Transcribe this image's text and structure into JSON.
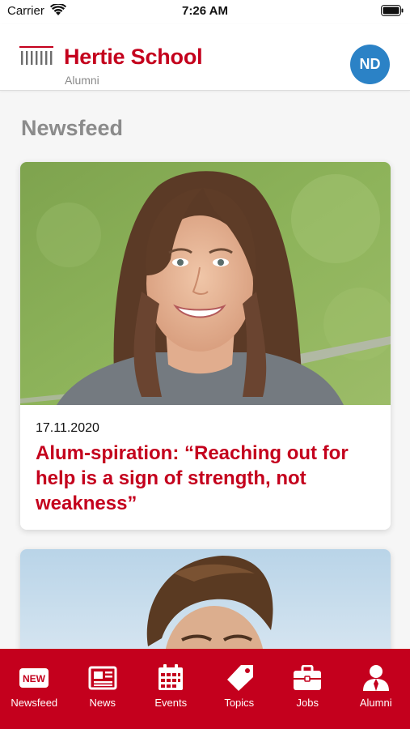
{
  "status_bar": {
    "carrier": "Carrier",
    "time": "7:26 AM"
  },
  "header": {
    "title": "Hertie School",
    "subtitle": "Alumni",
    "avatar_initials": "ND",
    "brand_color": "#c4001d",
    "avatar_color": "#2b82c6"
  },
  "page": {
    "title": "Newsfeed"
  },
  "cards": [
    {
      "date": "17.11.2020",
      "title": "Alum-spiration: “Reaching out for help is a sign of strength, not weakness”",
      "image": "portrait-woman-smiling-grass-background"
    },
    {
      "image": "portrait-man-sky-background"
    }
  ],
  "tab_bar": {
    "items": [
      {
        "label": "Newsfeed",
        "icon": "new-badge-icon",
        "badge_text": "NEW"
      },
      {
        "label": "News",
        "icon": "newspaper-icon"
      },
      {
        "label": "Events",
        "icon": "calendar-icon"
      },
      {
        "label": "Topics",
        "icon": "tag-icon"
      },
      {
        "label": "Jobs",
        "icon": "briefcase-icon"
      },
      {
        "label": "Alumni",
        "icon": "person-icon"
      }
    ]
  }
}
